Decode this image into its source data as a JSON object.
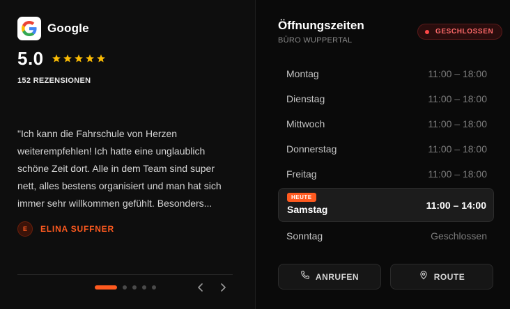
{
  "reviews": {
    "brand": "Google",
    "score": "5.0",
    "stars": 5,
    "count_label": "152 REZENSIONEN",
    "quote": "\"Ich kann die Fahrschule von Herzen weiterempfehlen! Ich hatte eine unglaublich schöne Zeit dort. Alle in dem Team sind super nett, alles bestens organisiert und man hat sich immer sehr willkommen gefühlt. Besonders...",
    "author_initial": "E",
    "author_name": "ELINA SUFFNER",
    "carousel": {
      "total": 5,
      "active": 1
    },
    "prev_icon": "chevron-left-icon",
    "next_icon": "chevron-right-icon"
  },
  "hours": {
    "title": "Öffnungszeiten",
    "subtitle": "BÜRO WUPPERTAL",
    "status": "GESCHLOSSEN",
    "today_label": "HEUTE",
    "days": [
      {
        "day": "Montag",
        "time": "11:00 – 18:00"
      },
      {
        "day": "Dienstag",
        "time": "11:00 – 18:00"
      },
      {
        "day": "Mittwoch",
        "time": "11:00 – 18:00"
      },
      {
        "day": "Donnerstag",
        "time": "11:00 – 18:00"
      },
      {
        "day": "Freitag",
        "time": "11:00 – 18:00"
      },
      {
        "day": "Samstag",
        "time": "11:00 – 14:00"
      },
      {
        "day": "Sonntag",
        "time": "Geschlossen"
      }
    ]
  },
  "actions": {
    "call_label": "ANRUFEN",
    "call_icon": "phone-icon",
    "route_label": "ROUTE",
    "route_icon": "map-pin-icon"
  },
  "colors": {
    "accent": "#ff5a1f",
    "star": "#fbbc04",
    "closed": "#ff4848"
  }
}
